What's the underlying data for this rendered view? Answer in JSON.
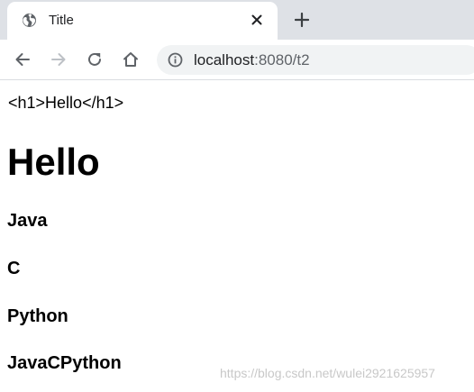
{
  "browser": {
    "tab": {
      "title": "Title",
      "favicon": "globe-icon",
      "close_icon": "close-icon"
    },
    "new_tab_icon": "plus-icon",
    "toolbar": {
      "back_icon": "arrow-left-icon",
      "forward_icon": "arrow-right-icon",
      "reload_icon": "reload-icon",
      "home_icon": "home-icon",
      "info_icon": "info-icon"
    },
    "address": {
      "host": "localhost",
      "rest": ":8080/t2"
    }
  },
  "page": {
    "raw_text": "<h1>Hello</h1>",
    "heading": "Hello",
    "items": [
      "Java",
      "C",
      "Python",
      "JavaCPython"
    ]
  },
  "watermark": "https://blog.csdn.net/wulei2921625957",
  "colors": {
    "tabstrip": "#dee1e6",
    "omnibox": "#f1f3f4",
    "icon": "#5f6368",
    "icon_disabled": "#bdc1c6"
  }
}
